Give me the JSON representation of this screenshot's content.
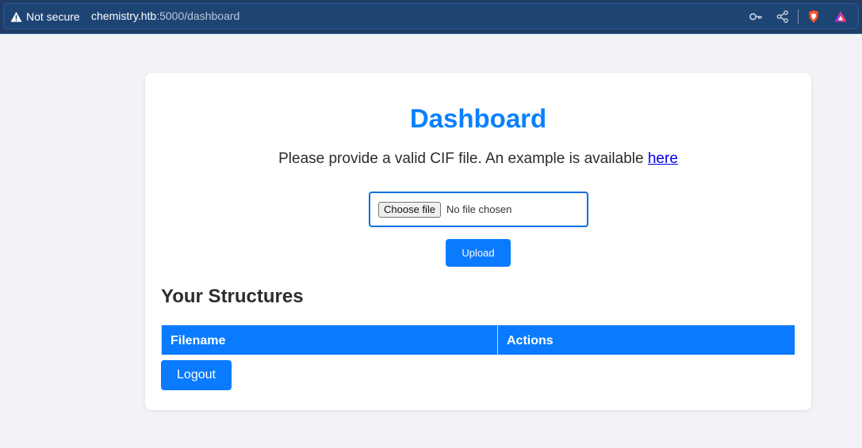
{
  "browser": {
    "security_label": "Not secure",
    "url_host": "chemistry.htb",
    "url_rest": ":5000/dashboard",
    "icons": [
      "key-icon",
      "share-icon",
      "brave-shield-icon",
      "brave-rewards-icon"
    ]
  },
  "page": {
    "title": "Dashboard",
    "intro_text": "Please provide a valid CIF file. An example is available ",
    "intro_link": "here",
    "file_button_label": "Choose file",
    "file_status": "No file chosen",
    "upload_label": "Upload",
    "section_title": "Your Structures",
    "table_headers": [
      "Filename",
      "Actions"
    ],
    "logout_label": "Logout"
  },
  "colors": {
    "accent": "#0a7bff",
    "title": "#0a80ff",
    "browser_bar": "#1f3d66",
    "background": "#f3f3f7"
  }
}
